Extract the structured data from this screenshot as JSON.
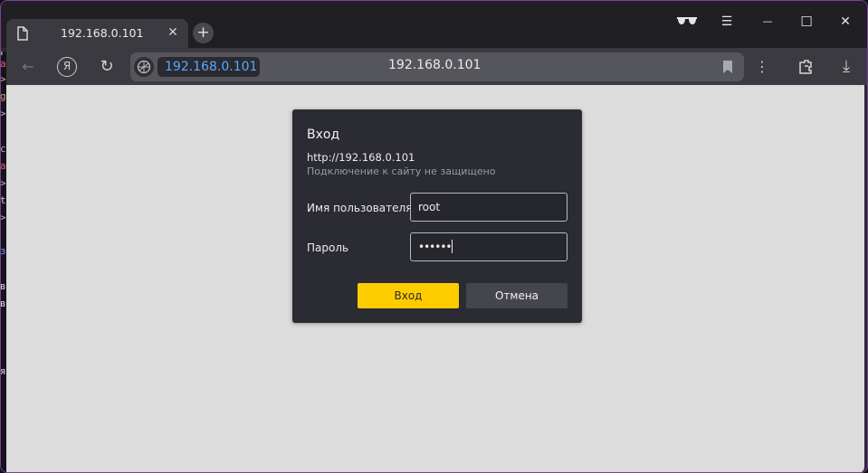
{
  "tab": {
    "title": "192.168.0.101",
    "close_glyph": "✕",
    "icon": "page-icon"
  },
  "new_tab": {
    "glyph": "+"
  },
  "window_controls": {
    "menu": "☰",
    "minimize": "—",
    "maximize": "☐",
    "close": "✕"
  },
  "toolbar": {
    "back_glyph": "←",
    "yandex_glyph": "Я",
    "reload_glyph": "↻",
    "more_glyph": "⋮",
    "download_glyph": "⤓"
  },
  "address": {
    "url_chip": "192.168.0.101",
    "url_center": "192.168.0.101"
  },
  "dialog": {
    "title": "Вход",
    "url": "http://192.168.0.101",
    "warning": "Подключение к сайту не защищено",
    "username_label": "Имя пользователя",
    "username_value": "root",
    "password_label": "Пароль",
    "password_value": "••••••",
    "ok_label": "Вход",
    "cancel_label": "Отмена"
  },
  "colors": {
    "accent": "#ffcc00",
    "url_blue": "#58a8ff",
    "window_border": "#7a3fa0"
  },
  "left_strip": {
    "glyphs": [
      "г",
      "д",
      "a",
      ">",
      "g",
      ">",
      "c",
      "a",
      ">",
      "t",
      ">",
      "з",
      "в",
      "в",
      "я"
    ]
  }
}
